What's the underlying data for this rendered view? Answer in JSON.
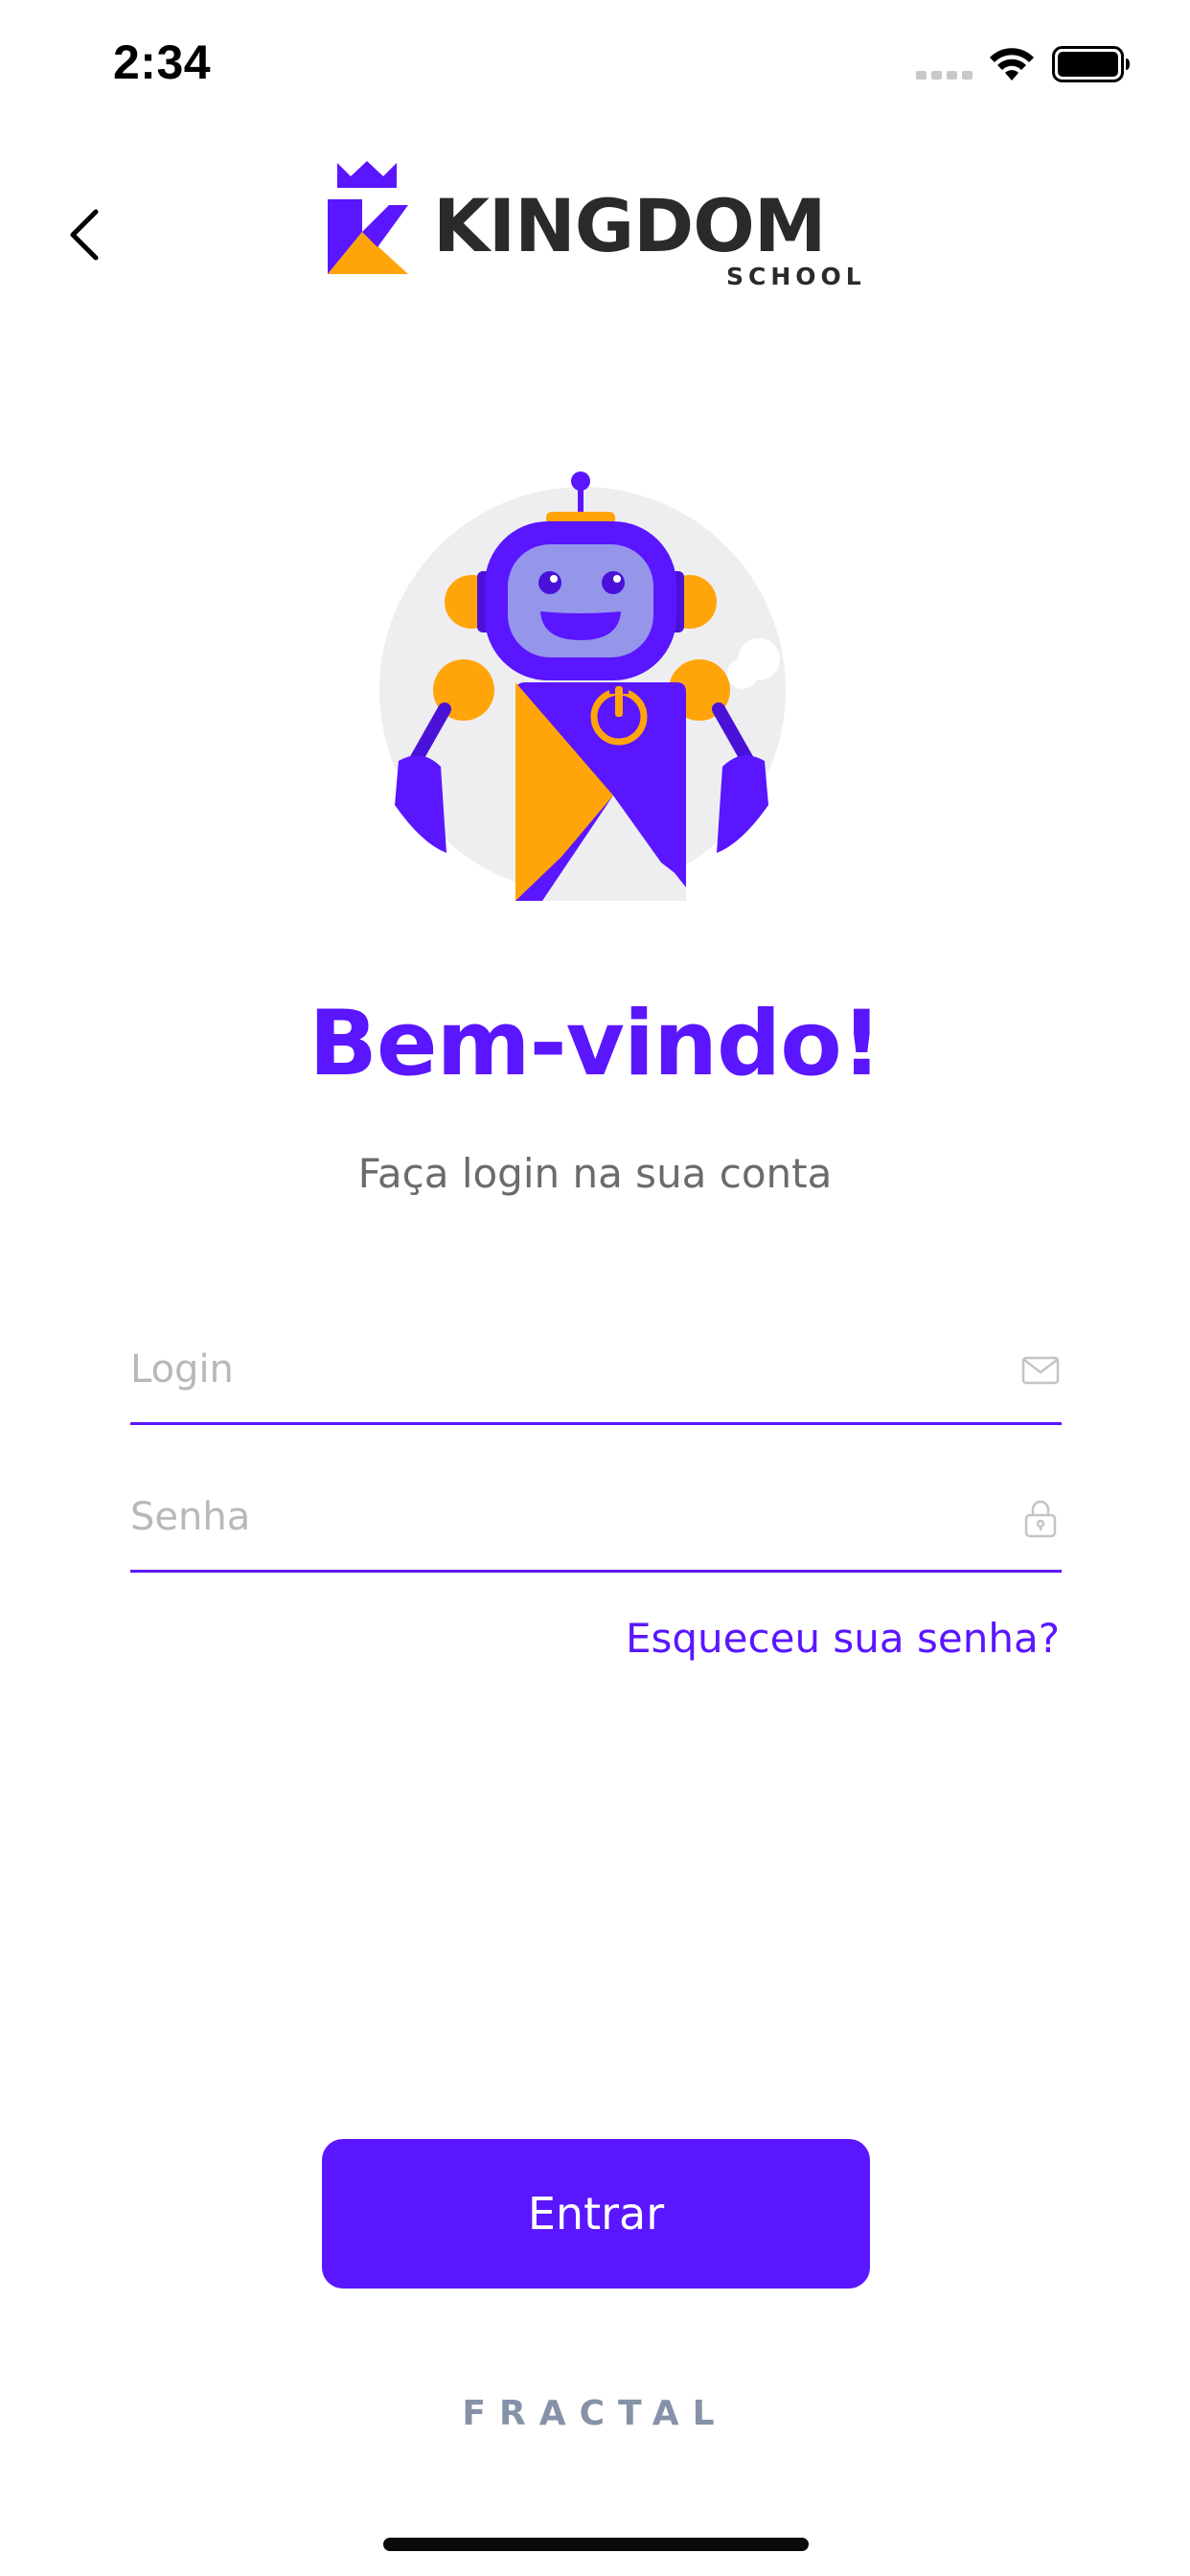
{
  "status_bar": {
    "time": "2:34"
  },
  "header": {
    "logo_title": "KINGDOM",
    "logo_subtitle": "SCHOOL"
  },
  "main": {
    "welcome": "Bem-vindo!",
    "subtitle": "Faça login na sua conta",
    "login_placeholder": "Login",
    "password_placeholder": "Senha",
    "forgot_password": "Esqueceu sua senha?",
    "submit_label": "Entrar"
  },
  "footer": {
    "brand": "FRACTAL"
  },
  "colors": {
    "accent": "#5a16ff",
    "orange": "#ffa50a",
    "text_gray": "#6b6b6b",
    "footer_gray": "#8592a8"
  }
}
